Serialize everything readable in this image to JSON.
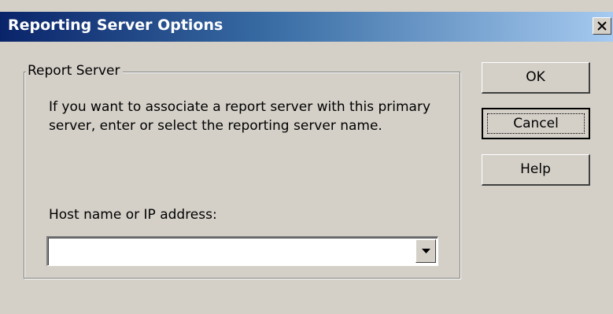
{
  "window": {
    "title": "Reporting Server Options",
    "close_icon": "close-icon"
  },
  "group": {
    "label": "Report Server",
    "description": "If you want to associate a report server with this primary server, enter or select the reporting server name.",
    "host_label": "Host name or IP address:",
    "host_value": "",
    "dropdown_icon": "chevron-down-icon"
  },
  "buttons": {
    "ok": "OK",
    "cancel": "Cancel",
    "help": "Help"
  },
  "colors": {
    "dialog_bg": "#d4d0c8",
    "title_start": "#0a246a",
    "title_end": "#a6caf0"
  }
}
